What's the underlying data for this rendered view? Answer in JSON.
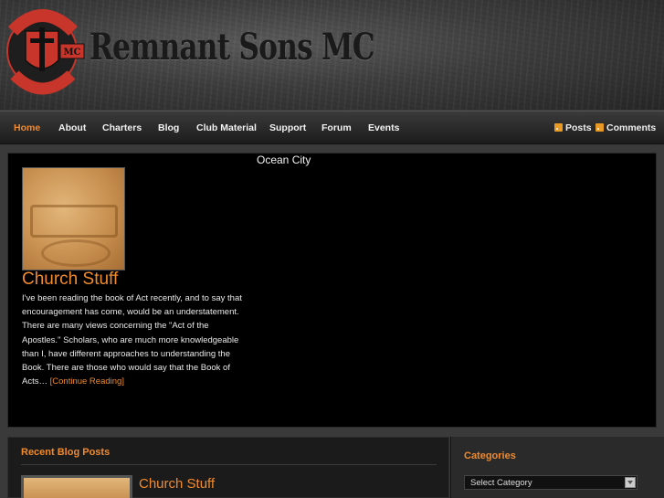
{
  "header": {
    "logo": {
      "top_text": "REMNANT SONS",
      "bottom_text": "HOLY CITY",
      "side_text": "MC"
    },
    "site_title": "Remnant Sons MC"
  },
  "nav": {
    "items": [
      {
        "label": "Home",
        "active": true
      },
      {
        "label": "About"
      },
      {
        "label": "Charters"
      },
      {
        "label": "Blog"
      },
      {
        "label": "Club Material"
      },
      {
        "label": "Support"
      },
      {
        "label": "Forum"
      },
      {
        "label": "Events"
      }
    ],
    "feeds": [
      {
        "label": "Posts",
        "icon": "rss-icon"
      },
      {
        "label": "Comments",
        "icon": "rss-icon"
      }
    ]
  },
  "featured": {
    "location": "Ocean City",
    "title": "Church Stuff",
    "excerpt": "I've been reading the book of Act recently, and to say that encouragement has come, would be an understatement. There are many views concerning the \"Act of the Apostles.\" Scholars, who are much more knowledgeable than I, have different approaches to understanding the Book. There are those who would say that the Book of Acts… ",
    "more_link": "[Continue Reading]"
  },
  "recent": {
    "heading": "Recent Blog Posts",
    "posts": [
      {
        "title": "Church Stuff"
      }
    ]
  },
  "sidebar": {
    "categories_heading": "Categories",
    "select_value": "Select Category"
  },
  "colors": {
    "accent": "#f08a2e",
    "background": "#3a3a3a",
    "panel": "#000000",
    "logo_red": "#c8352a"
  }
}
